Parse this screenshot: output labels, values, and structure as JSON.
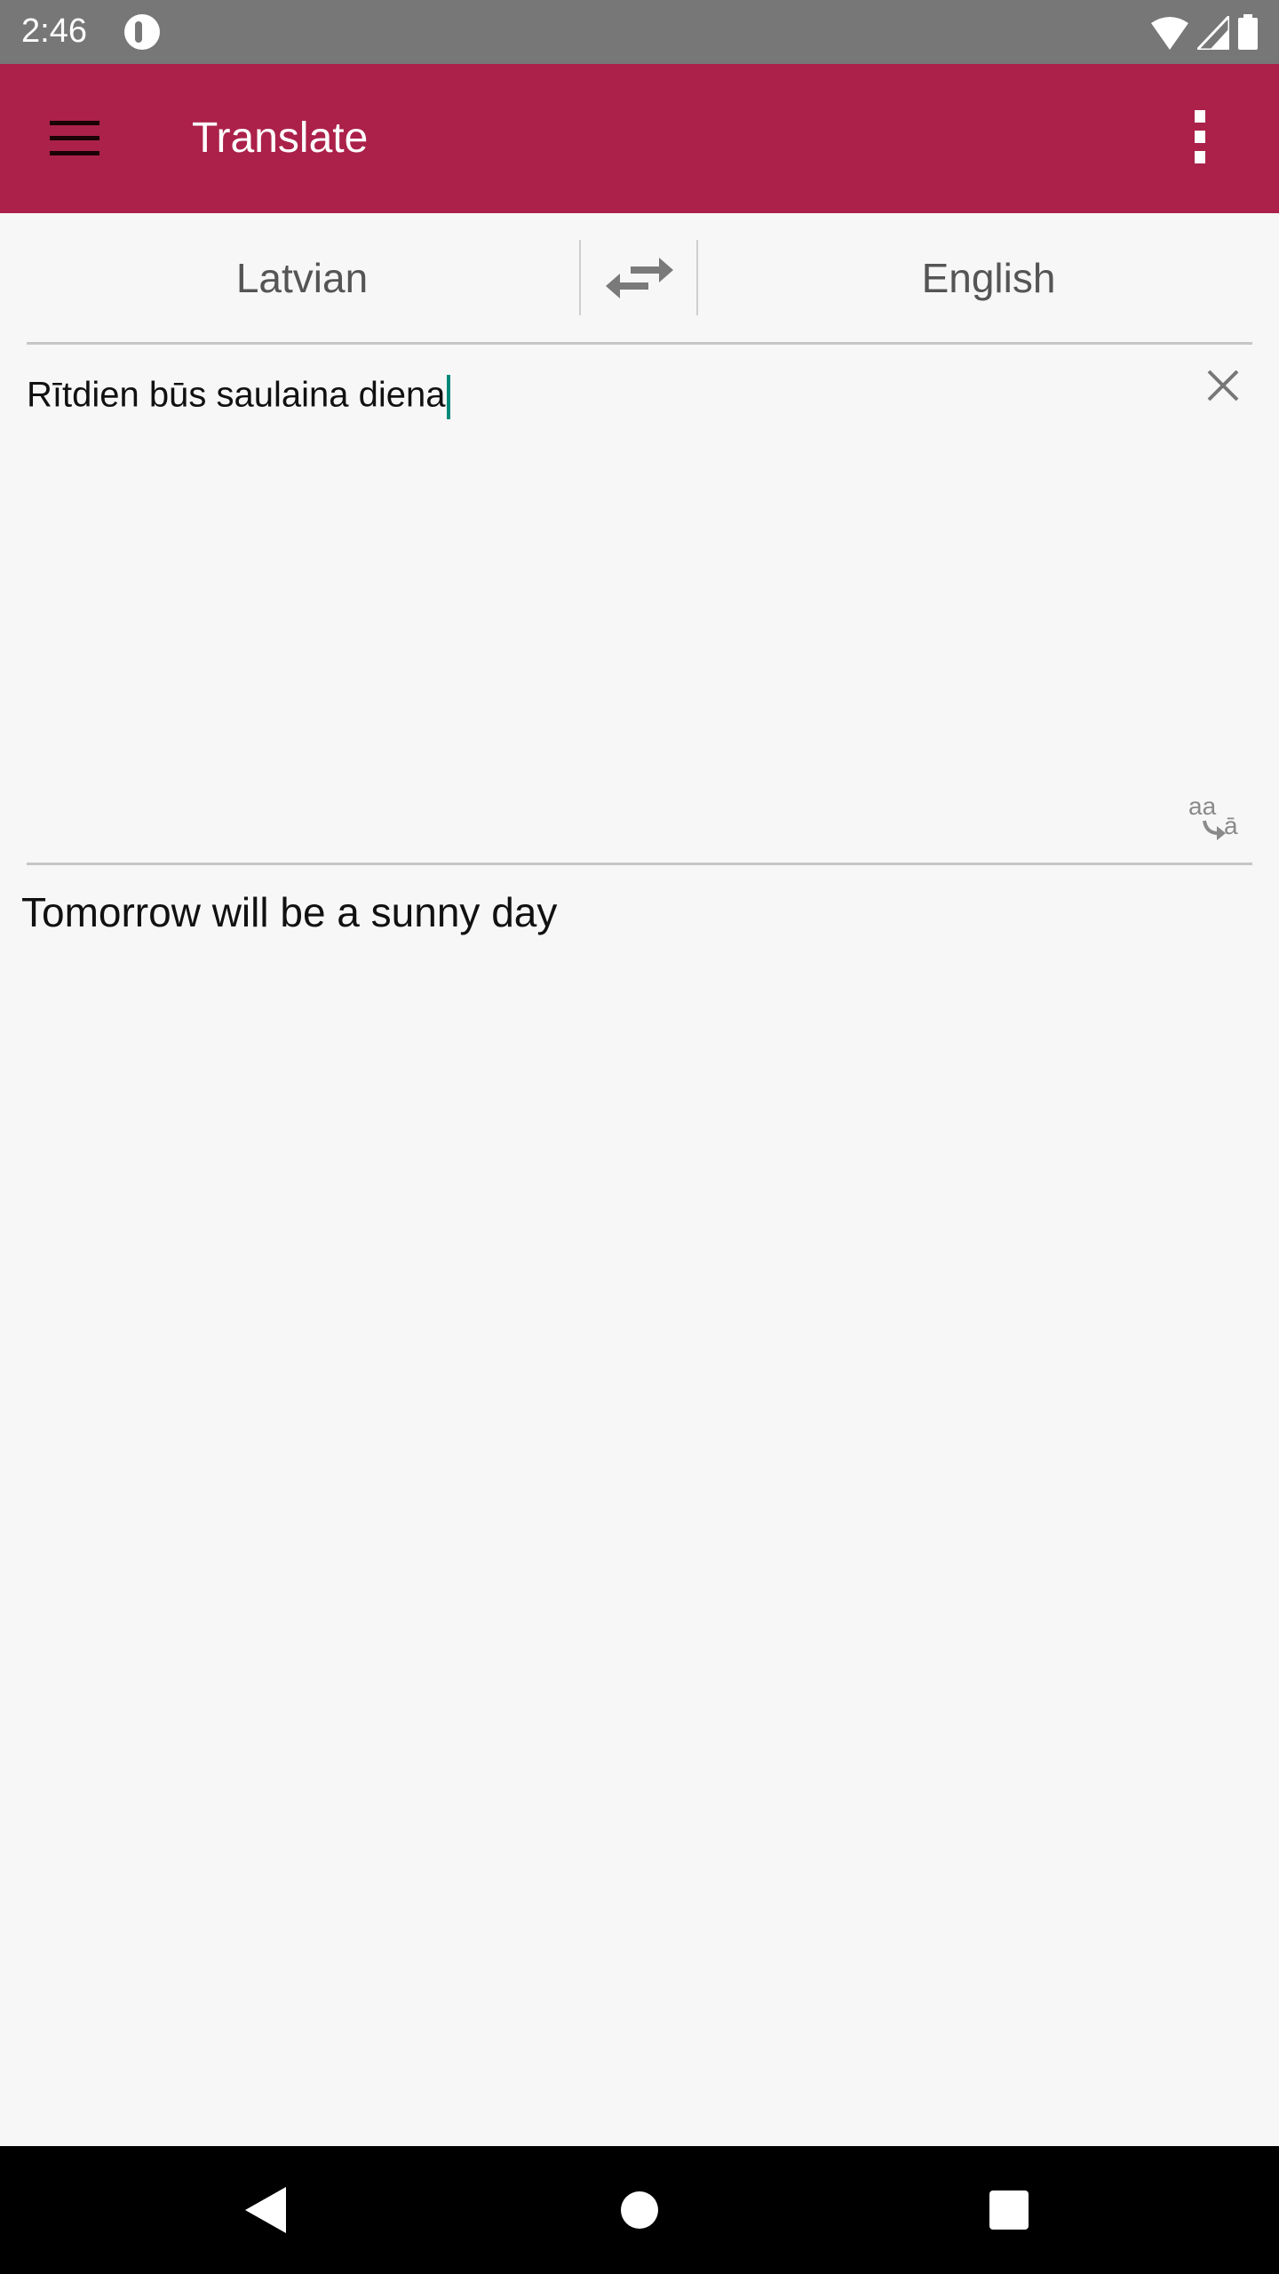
{
  "status_bar": {
    "time": "2:46",
    "icons": [
      "notification-icon",
      "wifi-icon",
      "signal-icon",
      "battery-icon"
    ]
  },
  "app_bar": {
    "title": "Translate",
    "background": "#ab214a"
  },
  "languages": {
    "source": "Latvian",
    "target": "English"
  },
  "input": {
    "value": "Rītdien būs saulaina diena",
    "caret_color": "#00897b"
  },
  "transliteration": {
    "from": "aa",
    "to": "ā"
  },
  "output": {
    "value": "Tomorrow will be a sunny day"
  }
}
